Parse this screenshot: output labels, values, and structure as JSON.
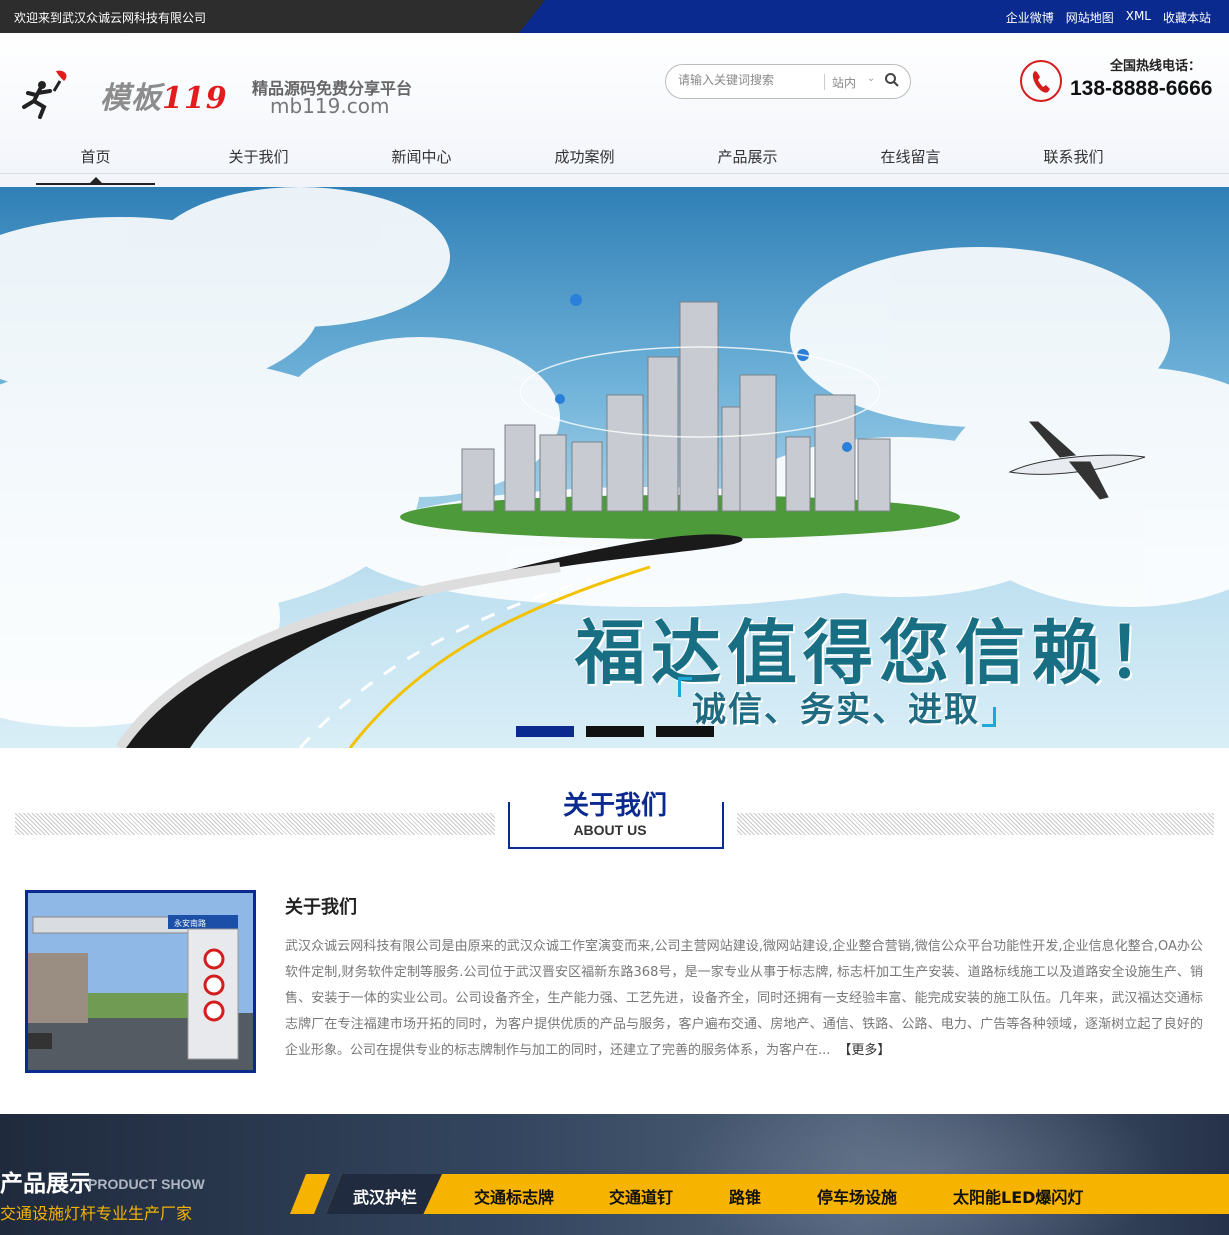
{
  "topbar": {
    "welcome": "欢迎来到武汉众诚云网科技有限公司",
    "links": [
      "企业微博",
      "网站地图",
      "XML",
      "收藏本站"
    ]
  },
  "header": {
    "logo_main": "模板",
    "logo_num": "119",
    "logo_slogan": "精品源码免费分享平台",
    "logo_url": "mb119.com",
    "search_placeholder": "请输入关键词搜索",
    "search_scope": "站内",
    "hotline_label": "全国热线电话：",
    "hotline_number": "138-8888-6666"
  },
  "nav": [
    "首页",
    "关于我们",
    "新闻中心",
    "成功案例",
    "产品展示",
    "在线留言",
    "联系我们"
  ],
  "banner": {
    "title": "福达值得您信赖！",
    "subtitle": "诚信、务实、进取",
    "slides": 3,
    "active_slide": 1
  },
  "about": {
    "section_title": "关于我们",
    "section_en": "ABOUT US",
    "heading": "关于我们",
    "text": "武汉众诚云网科技有限公司是由原来的武汉众诚工作室演变而来,公司主营网站建设,微网站建设,企业整合营销,微信公众平台功能性开发,企业信息化整合,OA办公软件定制,财务软件定制等服务.公司位于武汉晋安区福新东路368号，是一家专业从事于标志牌, 标志杆加工生产安装、道路标线施工以及道路安全设施生产、销售、安装于一体的实业公司。公司设备齐全，生产能力强、工艺先进，设备齐全，同时还拥有一支经验丰富、能完成安装的施工队伍。几年来，武汉福达交通标志牌厂在专注福建市场开拓的同时，为客户提供优质的产品与服务，客户遍布交通、房地产、通信、铁路、公路、电力、广告等各种领域，逐渐树立起了良好的企业形象。公司在提供专业的标志牌制作与加工的同时，还建立了完善的服务体系，为客户在...",
    "more": "【更多】",
    "image_sign_text": "永安南路"
  },
  "products": {
    "title": "产品展示",
    "title_en": "PRODUCT SHOW",
    "subtitle": "交通设施灯杆专业生产厂家",
    "tabs": [
      "武汉护栏",
      "交通标志牌",
      "交通道钉",
      "路锥",
      "停车场设施",
      "太阳能LED爆闪灯"
    ],
    "active_tab": 0
  },
  "colors": {
    "brand_blue": "#0a2a8f",
    "accent_yellow": "#f6b400",
    "hotline_red": "#d41d1d"
  }
}
